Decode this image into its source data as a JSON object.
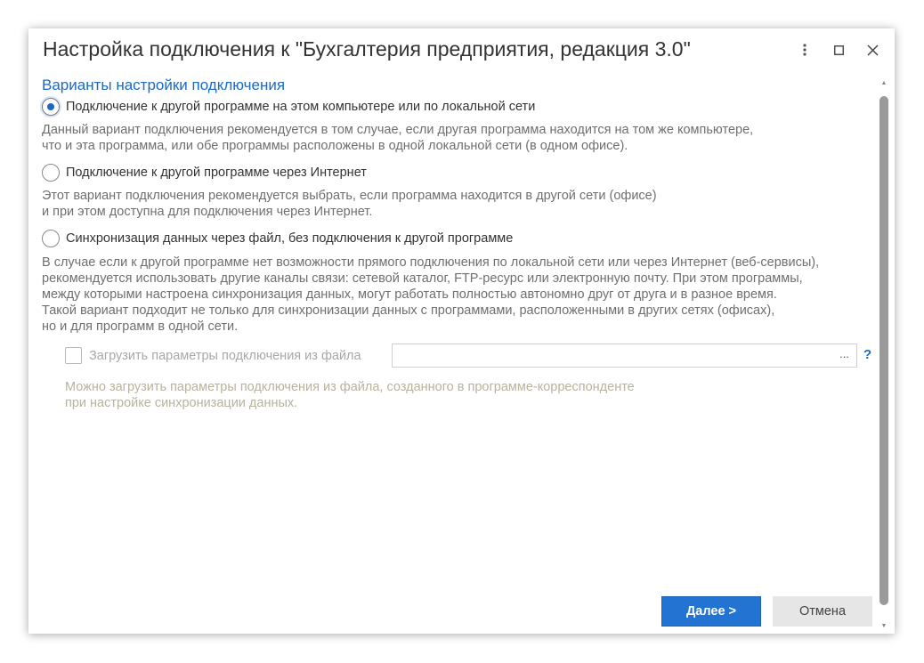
{
  "window": {
    "title": "Настройка подключения к \"Бухгалтерия предприятия, редакция 3.0\""
  },
  "section_title": "Варианты настройки подключения",
  "options": [
    {
      "label": "Подключение к другой программе на этом компьютере или по локальной сети",
      "checked": true,
      "desc": [
        "Данный вариант подключения рекомендуется в том случае, если другая программа находится на том же компьютере,",
        "что и эта программа, или обе программы расположены в одной локальной сети (в одном офисе)."
      ]
    },
    {
      "label": "Подключение к другой программе через Интернет",
      "checked": false,
      "desc": [
        "Этот вариант подключения рекомендуется выбрать, если программа находится в другой сети (офисе)",
        "и при этом доступна для подключения через Интернет."
      ]
    },
    {
      "label": "Синхронизация данных через файл, без подключения к другой программе",
      "checked": false,
      "desc": [
        "В случае если к другой программе нет возможности прямого подключения по локальной сети или через Интернет (веб-сервисы),",
        "рекомендуется использовать другие каналы связи: сетевой каталог, FTP-ресурс или электронную почту. При этом программы,",
        "между которыми настроена синхронизация данных, могут работать полностью автономно друг от друга и в разное время.",
        "Такой вариант подходит не только для синхронизации данных с программами, расположенными в других сетях (офисах),",
        "но и для программ в одной сети."
      ]
    }
  ],
  "load_from_file": {
    "label": "Загрузить параметры подключения из файла",
    "value": "",
    "browse_label": "...",
    "help_label": "?",
    "hint": [
      "Можно загрузить параметры подключения из файла, созданного в программе-корреспонденте",
      "при настройке синхронизации данных."
    ]
  },
  "buttons": {
    "next": "Далее >",
    "cancel": "Отмена"
  },
  "colors": {
    "accent": "#1c69c4",
    "primary_button": "#2273d2",
    "disabled_hint": "#b7b39c"
  }
}
